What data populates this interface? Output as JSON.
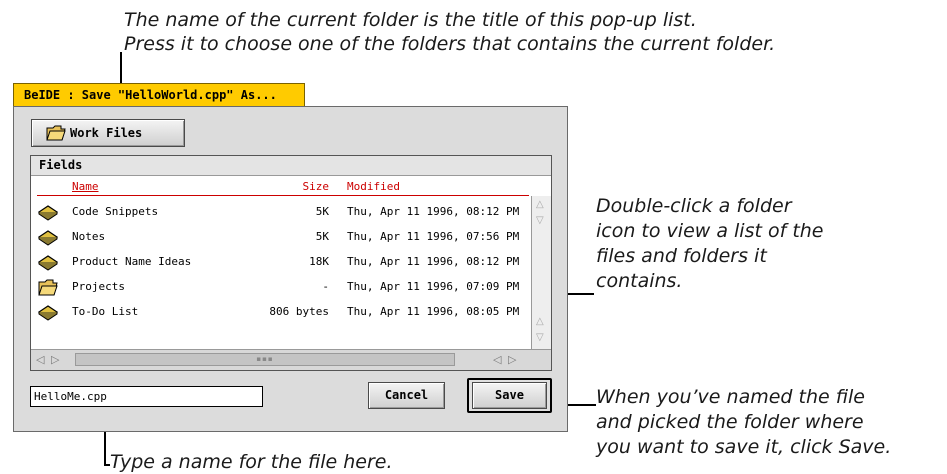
{
  "callouts": {
    "top_line1": "The name of the current folder is the title of this pop-up list.",
    "top_line2": "Press it to choose one of the folders that contains the current folder.",
    "right_line1": "Double-click a folder",
    "right_line2": "icon to view a list of the",
    "right_line3": "files and folders it",
    "right_line4": "contains.",
    "save_line1": "When you’ve named the file",
    "save_line2": "and picked the folder where",
    "save_line3": "you want to save it, click Save.",
    "bottom_line1": "Type a name for the file here."
  },
  "window": {
    "title": "BeIDE : Save \"HelloWorld.cpp\" As..."
  },
  "folder_popup": {
    "label": "Work Files",
    "icon": "open-folder-icon"
  },
  "list": {
    "header": "Fields",
    "columns": {
      "name": "Name",
      "size": "Size",
      "modified": "Modified"
    },
    "rows": [
      {
        "name": "Code Snippets",
        "size": "5K",
        "modified": "Thu, Apr 11 1996, 08:12 PM",
        "icon": "file-icon"
      },
      {
        "name": "Notes",
        "size": "5K",
        "modified": "Thu, Apr 11 1996, 07:56 PM",
        "icon": "file-icon"
      },
      {
        "name": "Product Name Ideas",
        "size": "18K",
        "modified": "Thu, Apr 11 1996, 08:12 PM",
        "icon": "file-icon"
      },
      {
        "name": "Projects",
        "size": "-",
        "modified": "Thu, Apr 11 1996, 07:09 PM",
        "icon": "folder-icon"
      },
      {
        "name": "To-Do List",
        "size": "806 bytes",
        "modified": "Thu, Apr 11 1996, 08:05 PM",
        "icon": "file-icon"
      }
    ]
  },
  "filename_field": {
    "value": "HelloMe.cpp"
  },
  "buttons": {
    "cancel": "Cancel",
    "save": "Save"
  },
  "colors": {
    "title_tab": "#ffcb00",
    "column_header": "#cc0000"
  }
}
